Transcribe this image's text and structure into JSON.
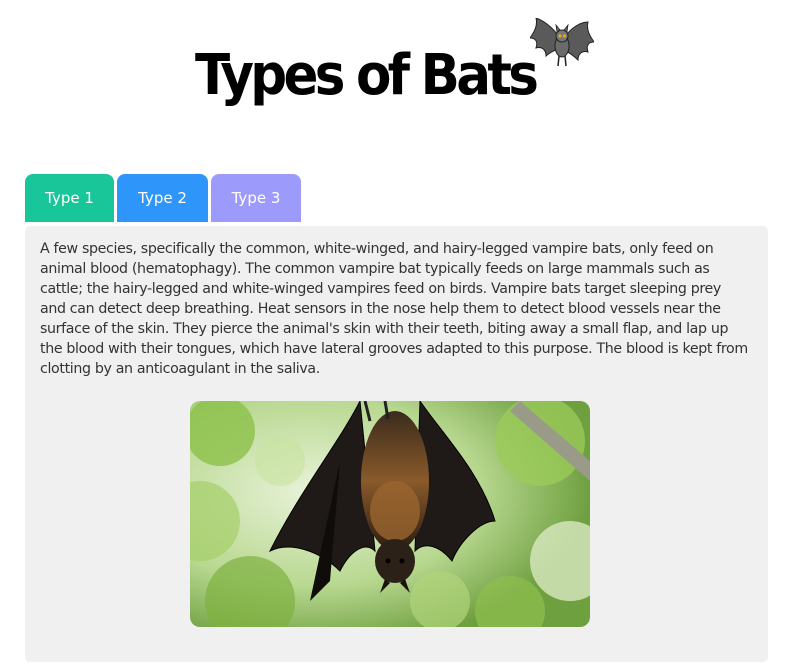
{
  "header": {
    "title": "Types of Bats",
    "logo_icon": "bat-icon"
  },
  "tabs": [
    {
      "label": "Type 1",
      "color": "#19c699"
    },
    {
      "label": "Type 2",
      "color": "#2e96fa"
    },
    {
      "label": "Type 3",
      "color": "#9c9bfb"
    }
  ],
  "panel": {
    "text": "A few species, specifically the common, white-winged, and hairy-legged vampire bats, only feed on animal blood (hematophagy). The common vampire bat typically feeds on large mammals such as cattle; the hairy-legged and white-winged vampires feed on birds. Vampire bats target sleeping prey and can detect deep breathing. Heat sensors in the nose help them to detect blood vessels near the surface of the skin. They pierce the animal's skin with their teeth, biting away a small flap, and lap up the blood with their tongues, which have lateral grooves adapted to this purpose. The blood is kept from clotting by an anticoagulant in the saliva.",
    "background": "#f0f0f0",
    "image_icon": "hanging-bat-photo"
  }
}
